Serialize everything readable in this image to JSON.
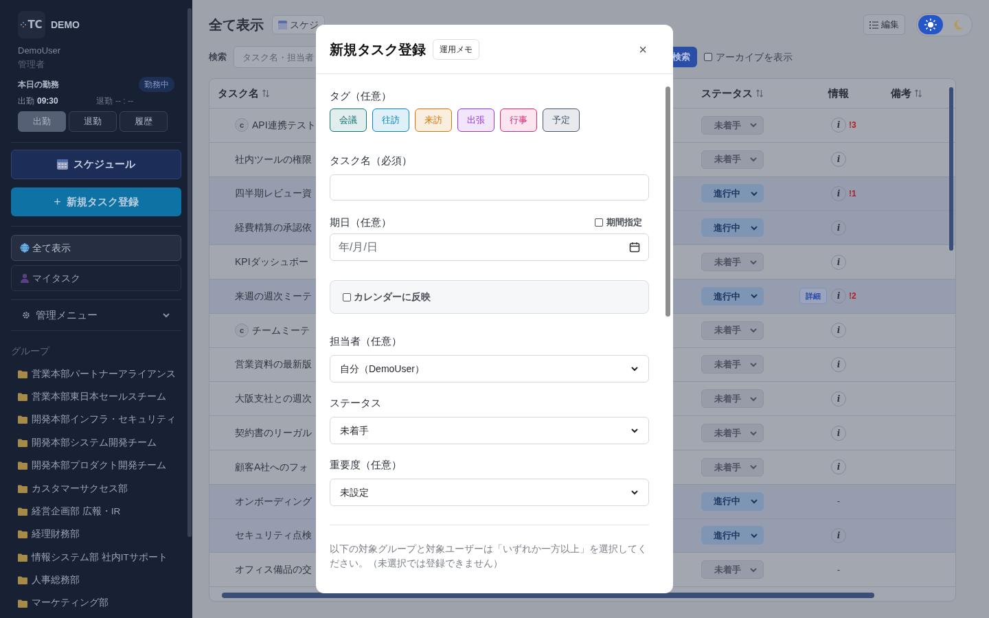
{
  "sidebar": {
    "logo_text": "TC",
    "brand": "DEMO",
    "user": "DemoUser",
    "role": "管理者",
    "attendance": {
      "title": "本日の勤務",
      "badge": "勤務中",
      "clock_in_label": "出勤",
      "clock_in_time": "09:30",
      "clock_out_label": "退勤",
      "clock_out_time": "-- : --",
      "buttons": [
        {
          "label": "出勤",
          "disabled": true
        },
        {
          "label": "退勤",
          "disabled": false
        },
        {
          "label": "履歴",
          "disabled": false
        }
      ]
    },
    "schedule_button": "スケジュール",
    "new_task_button": "新規タスク登録",
    "plus": "+",
    "nav": [
      {
        "label": "全て表示",
        "kind": "globe",
        "selected": true
      },
      {
        "label": "マイタスク",
        "kind": "person",
        "selected": false
      }
    ],
    "admin_menu": {
      "label": "管理メニュー",
      "expanded": false
    },
    "groups_heading": "グループ",
    "groups": [
      "営業本部パートナーアライアンス",
      "営業本部東日本セールスチーム",
      "開発本部インフラ・セキュリティ",
      "開発本部システム開発チーム",
      "開発本部プロダクト開発チーム",
      "カスタマーサクセス部",
      "経営企画部 広報・IR",
      "経理財務部",
      "情報システム部 社内ITサポート",
      "人事総務部",
      "マーケティング部"
    ]
  },
  "header": {
    "title": "全て表示",
    "schedule_button": "スケジ",
    "search_label": "検索",
    "search_placeholder": "タスク名・担当者",
    "search_button": "検索",
    "archive_checkbox": {
      "label": "アーカイブを表示",
      "checked": false
    },
    "edit_button": "編集",
    "theme_toggle": [
      {
        "kind": "light",
        "selected": true
      },
      {
        "kind": "dark",
        "selected": false
      }
    ]
  },
  "table": {
    "columns": [
      {
        "label": "タスク名",
        "sortable": true
      },
      {
        "label": "ステータス",
        "sortable": true
      },
      {
        "label": "情報",
        "sortable": false
      },
      {
        "label": "備考",
        "sortable": true
      }
    ],
    "rows": [
      {
        "name": "API連携テスト",
        "recurring": "c",
        "status": {
          "label": "未着手",
          "kind": "not_started"
        },
        "info": {
          "kind": "icon",
          "text": "i"
        },
        "alert": "!3"
      },
      {
        "name": "社内ツールの権限",
        "status": {
          "label": "未着手",
          "kind": "not_started"
        },
        "info": {
          "kind": "icon",
          "text": "i"
        }
      },
      {
        "name": "四半期レビュー資",
        "status": {
          "label": "進行中",
          "kind": "in_progress"
        },
        "info": {
          "kind": "icon",
          "text": "i"
        },
        "alert": "!1"
      },
      {
        "name": "経費精算の承認依",
        "status": {
          "label": "進行中",
          "kind": "in_progress"
        },
        "info": {
          "kind": "icon",
          "text": "i"
        }
      },
      {
        "name": "KPIダッシュボー",
        "status": {
          "label": "未着手",
          "kind": "not_started"
        },
        "info": {
          "kind": "icon",
          "text": "i"
        }
      },
      {
        "name": "来週の週次ミーテ",
        "status": {
          "label": "進行中",
          "kind": "in_progress"
        },
        "detail_button": "詳細",
        "info": {
          "kind": "icon",
          "text": "i"
        },
        "alert": "!2"
      },
      {
        "name": "チームミーテ",
        "recurring": "c",
        "status": {
          "label": "未着手",
          "kind": "not_started"
        },
        "info": {
          "kind": "icon",
          "text": "i"
        }
      },
      {
        "name": "営業資料の最新版",
        "status": {
          "label": "未着手",
          "kind": "not_started"
        },
        "info": {
          "kind": "icon",
          "text": "i"
        }
      },
      {
        "name": "大阪支社との週次",
        "status": {
          "label": "未着手",
          "kind": "not_started"
        },
        "info": {
          "kind": "icon",
          "text": "i"
        }
      },
      {
        "name": "契約書のリーガル",
        "status": {
          "label": "未着手",
          "kind": "not_started"
        },
        "info": {
          "kind": "icon",
          "text": "i"
        }
      },
      {
        "name": "顧客A社へのフォ",
        "status": {
          "label": "未着手",
          "kind": "not_started"
        },
        "info": {
          "kind": "icon",
          "text": "i"
        }
      },
      {
        "name": "オンボーディング",
        "status": {
          "label": "進行中",
          "kind": "in_progress"
        },
        "info": {
          "kind": "dash",
          "text": "-"
        }
      },
      {
        "name": "セキュリティ点検",
        "status": {
          "label": "進行中",
          "kind": "in_progress"
        },
        "info": {
          "kind": "icon",
          "text": "i"
        }
      },
      {
        "name": "オフィス備品の交",
        "status": {
          "label": "未着手",
          "kind": "not_started"
        },
        "info": {
          "kind": "dash",
          "text": "-"
        }
      }
    ]
  },
  "modal": {
    "title": "新規タスク登録",
    "memo_button": "運用メモ",
    "close": "×",
    "tags_label": "タグ（任意）",
    "tags": [
      {
        "label": "会議",
        "color": "#0f766e"
      },
      {
        "label": "往訪",
        "color": "#0284c7"
      },
      {
        "label": "来訪",
        "color": "#d97706"
      },
      {
        "label": "出張",
        "color": "#9333ea"
      },
      {
        "label": "行事",
        "color": "#db2777"
      },
      {
        "label": "予定",
        "color": "#475569"
      }
    ],
    "task_name_label": "タスク名（必須）",
    "due_label": "期日（任意）",
    "period_checkbox": {
      "label": "期間指定",
      "checked": false
    },
    "date_placeholder": "年/月/日",
    "calendar_checkbox": {
      "label": "カレンダーに反映",
      "checked": false
    },
    "assignee_label": "担当者（任意）",
    "assignee_value": "自分（DemoUser）",
    "status_label": "ステータス",
    "status_value": "未着手",
    "priority_label": "重要度（任意）",
    "priority_value": "未設定",
    "note": "以下の対象グループと対象ユーザーは「いずれか一方以上」を選択してください。（未選択では登録できません）"
  }
}
